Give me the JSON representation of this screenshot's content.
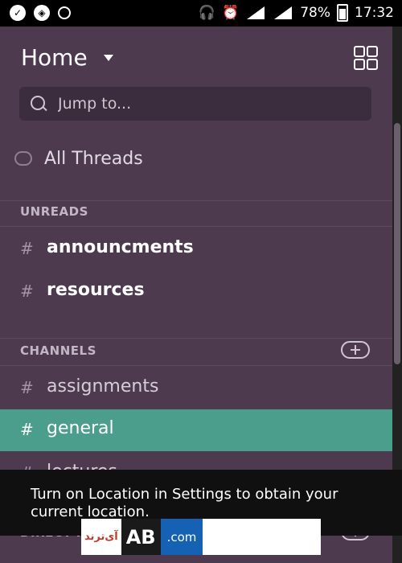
{
  "status": {
    "battery": "78%",
    "time": "17:32",
    "network": "4G"
  },
  "header": {
    "title": "Home"
  },
  "search": {
    "placeholder": "Jump to..."
  },
  "threads": {
    "label": "All Threads"
  },
  "sections": {
    "unreads": {
      "label": "UNREADS",
      "channels": [
        {
          "name": "announcments"
        },
        {
          "name": "resources"
        }
      ]
    },
    "channels": {
      "label": "CHANNELS",
      "channels": [
        {
          "name": "assignments"
        },
        {
          "name": "general",
          "selected": true
        },
        {
          "name": "lectures"
        }
      ]
    },
    "direct": {
      "label": "DIRECT M"
    }
  },
  "toast": {
    "message": "Turn on Location in Settings to obtain your current location."
  },
  "watermark": {
    "persian": "آی‌ترند",
    "letters": "AB",
    "com": ".com"
  },
  "colors": {
    "sidebar": "#4d3a4f",
    "selected": "#4b9d8c",
    "toast": "#101010"
  }
}
